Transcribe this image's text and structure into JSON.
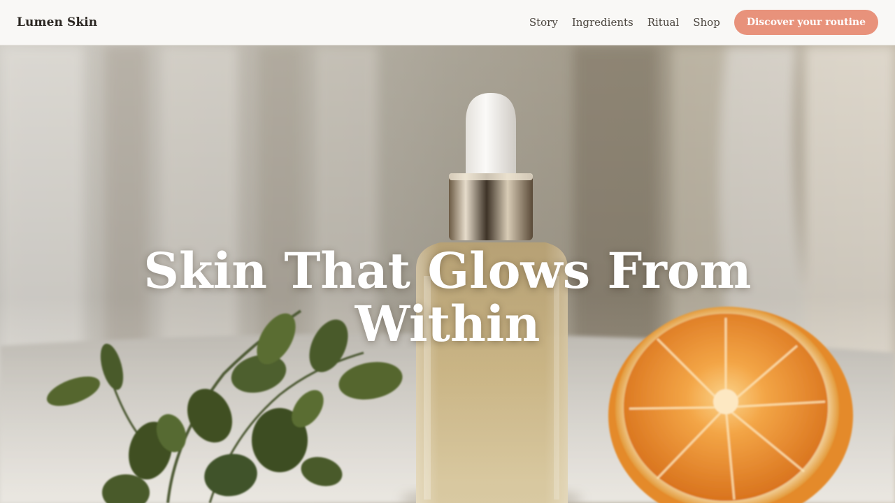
{
  "header": {
    "brand": "Lumen Skin",
    "nav": [
      {
        "label": "Story"
      },
      {
        "label": "Ingredients"
      },
      {
        "label": "Ritual"
      },
      {
        "label": "Shop"
      }
    ],
    "cta_label": "Discover your routine"
  },
  "hero": {
    "title_line1": "Skin That Glows From",
    "title_line2": "Within",
    "image_subject": "serum dropper bottle with eucalyptus sprig and halved orange"
  },
  "colors": {
    "accent": "#e8927b",
    "header_bg": "#f9f8f6",
    "brand_text": "#2b2722",
    "nav_text": "#4a443d",
    "hero_text": "#ffffff"
  }
}
